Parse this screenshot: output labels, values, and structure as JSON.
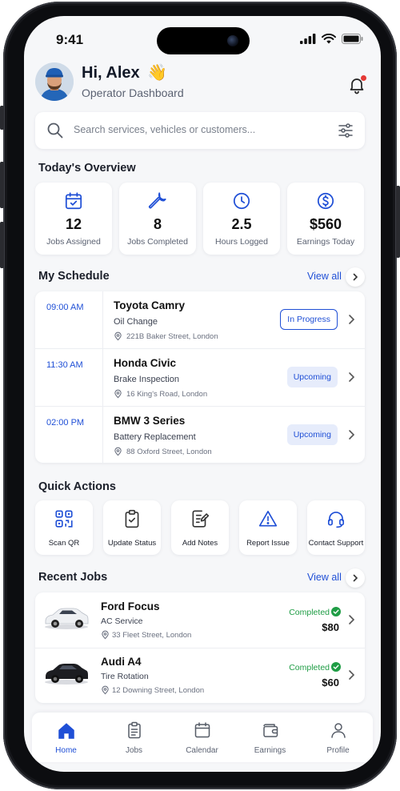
{
  "status_bar": {
    "time": "9:41"
  },
  "header": {
    "greeting": "Hi, Alex",
    "wave_emoji": "👋",
    "subtitle": "Operator Dashboard",
    "notification_dot_color": "#e53935"
  },
  "search": {
    "placeholder": "Search services, vehicles or customers..."
  },
  "overview": {
    "title": "Today's Overview",
    "cards": [
      {
        "icon": "calendar-check-icon",
        "value": "12",
        "label": "Jobs Assigned"
      },
      {
        "icon": "wrench-icon",
        "value": "8",
        "label": "Jobs Completed"
      },
      {
        "icon": "clock-icon",
        "value": "2.5",
        "label": "Hours Logged"
      },
      {
        "icon": "dollar-circle-icon",
        "value": "$560",
        "label": "Earnings Today"
      }
    ]
  },
  "schedule": {
    "title": "My Schedule",
    "view_all": "View all",
    "items": [
      {
        "time": "09:00 AM",
        "vehicle": "Toyota Camry",
        "service": "Oil Change",
        "address": "221B Baker Street, London",
        "status": "In Progress"
      },
      {
        "time": "11:30 AM",
        "vehicle": "Honda Civic",
        "service": "Brake Inspection",
        "address": "16 King's Road, London",
        "status": "Upcoming"
      },
      {
        "time": "02:00 PM",
        "vehicle": "BMW 3 Series",
        "service": "Battery Replacement",
        "address": "88 Oxford Street, London",
        "status": "Upcoming"
      }
    ]
  },
  "quick_actions": {
    "title": "Quick Actions",
    "items": [
      {
        "icon": "qr-code-icon",
        "label": "Scan QR"
      },
      {
        "icon": "clipboard-check-icon",
        "label": "Update Status"
      },
      {
        "icon": "edit-note-icon",
        "label": "Add Notes"
      },
      {
        "icon": "warning-icon",
        "label": "Report Issue"
      },
      {
        "icon": "headset-icon",
        "label": "Contact Support"
      }
    ]
  },
  "recent_jobs": {
    "title": "Recent Jobs",
    "view_all": "View all",
    "items": [
      {
        "vehicle": "Ford Focus",
        "service": "AC Service",
        "address": "33 Fleet Street, London",
        "status": "Completed",
        "price": "$80",
        "car_color": "#f2f3f5"
      },
      {
        "vehicle": "Audi A4",
        "service": "Tire Rotation",
        "address": "12 Downing Street, London",
        "status": "Completed",
        "price": "$60",
        "car_color": "#1c1d21"
      }
    ]
  },
  "bottom_nav": {
    "items": [
      {
        "icon": "home-icon",
        "label": "Home",
        "active": true
      },
      {
        "icon": "clipboard-icon",
        "label": "Jobs",
        "active": false
      },
      {
        "icon": "calendar-icon",
        "label": "Calendar",
        "active": false
      },
      {
        "icon": "wallet-icon",
        "label": "Earnings",
        "active": false
      },
      {
        "icon": "person-icon",
        "label": "Profile",
        "active": false
      }
    ]
  },
  "colors": {
    "accent": "#1f4fd6",
    "success": "#1f9d45",
    "background": "#f6f7f9"
  }
}
